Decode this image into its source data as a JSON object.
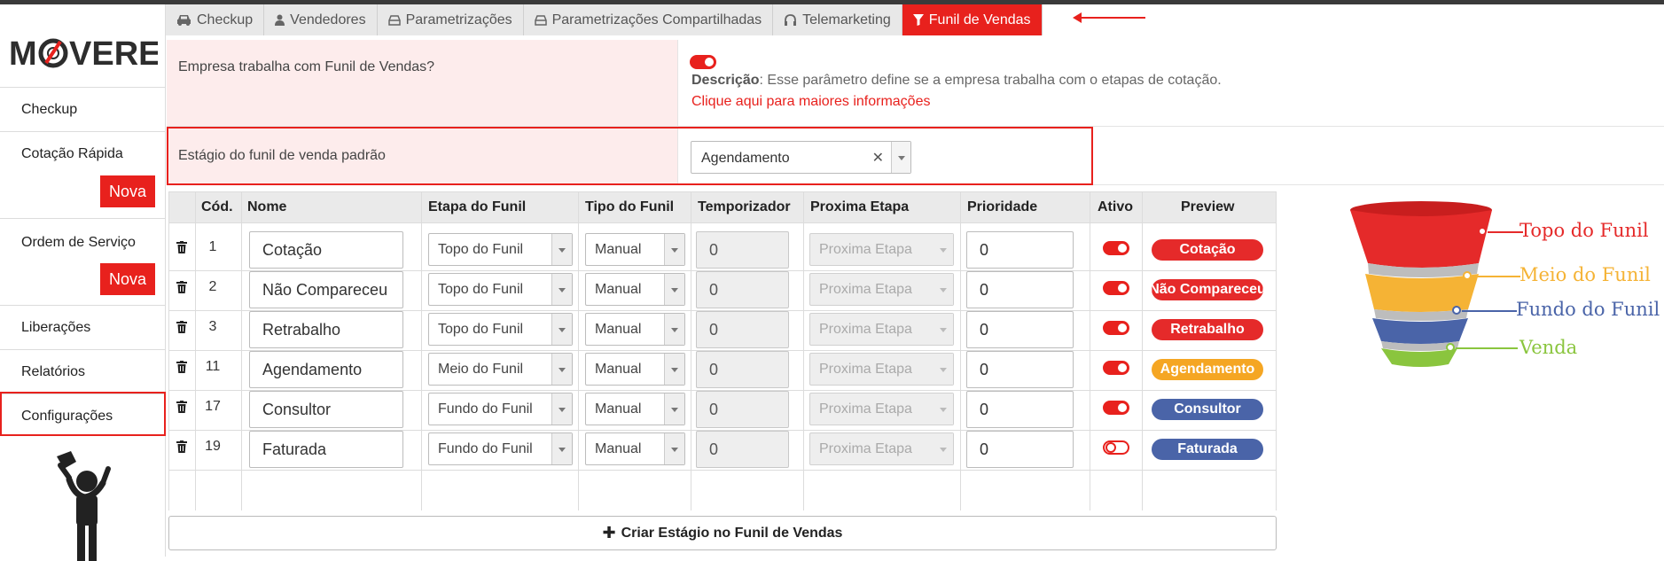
{
  "sidebar": {
    "logo_text": "MOVERE",
    "items": [
      {
        "label": "Checkup"
      },
      {
        "label": "Cotação Rápida",
        "badge": "Nova"
      },
      {
        "label": "Ordem de Serviço",
        "badge": "Nova"
      },
      {
        "label": "Liberações"
      },
      {
        "label": "Relatórios"
      },
      {
        "label": "Configurações"
      }
    ]
  },
  "tabs": [
    {
      "label": "Checkup",
      "icon": "car-icon"
    },
    {
      "label": "Vendedores",
      "icon": "user-icon"
    },
    {
      "label": "Parametrizações",
      "icon": "hdd-icon"
    },
    {
      "label": "Parametrizações Compartilhadas",
      "icon": "hdd-icon"
    },
    {
      "label": "Telemarketing",
      "icon": "headset-icon"
    },
    {
      "label": "Funil de Vendas",
      "icon": "filter-icon",
      "active": true
    }
  ],
  "params": {
    "funnel_question": "Empresa trabalha com Funil de Vendas?",
    "funnel_enabled": true,
    "desc_label": "Descrição",
    "desc_text": ": Esse parâmetro define se a empresa trabalha com o etapas de cotação.",
    "more_info": "Clique aqui para maiores informações",
    "default_stage_label": "Estágio do funil de venda padrão",
    "default_stage_value": "Agendamento"
  },
  "table": {
    "headers": {
      "code": "Cód.",
      "name": "Nome",
      "stage": "Etapa do Funil",
      "type": "Tipo do Funil",
      "timer": "Temporizador",
      "next": "Proxima Etapa",
      "priority": "Prioridade",
      "active": "Ativo",
      "preview": "Preview"
    },
    "rows": [
      {
        "code": "1",
        "name": "Cotação",
        "stage": "Topo do Funil",
        "type": "Manual",
        "timer": "0",
        "next": "Proxima Etapa",
        "priority": "0",
        "active": true,
        "preview": "Cotação",
        "color": "#e52a2a"
      },
      {
        "code": "2",
        "name": "Não Compareceu",
        "stage": "Topo do Funil",
        "type": "Manual",
        "timer": "0",
        "next": "Proxima Etapa",
        "priority": "0",
        "active": true,
        "preview": "Não Compareceu",
        "color": "#e52a2a"
      },
      {
        "code": "3",
        "name": "Retrabalho",
        "stage": "Topo do Funil",
        "type": "Manual",
        "timer": "0",
        "next": "Proxima Etapa",
        "priority": "0",
        "active": true,
        "preview": "Retrabalho",
        "color": "#e52a2a"
      },
      {
        "code": "11",
        "name": "Agendamento",
        "stage": "Meio do Funil",
        "type": "Manual",
        "timer": "0",
        "next": "Proxima Etapa",
        "priority": "0",
        "active": true,
        "preview": "Agendamento",
        "color": "#f5a623"
      },
      {
        "code": "17",
        "name": "Consultor",
        "stage": "Fundo do Funil",
        "type": "Manual",
        "timer": "0",
        "next": "Proxima Etapa",
        "priority": "0",
        "active": true,
        "preview": "Consultor",
        "color": "#4a64a8"
      },
      {
        "code": "19",
        "name": "Faturada",
        "stage": "Fundo do Funil",
        "type": "Manual",
        "timer": "0",
        "next": "Proxima Etapa",
        "priority": "0",
        "active": false,
        "preview": "Faturada",
        "color": "#4a64a8"
      }
    ],
    "add_button": "Criar Estágio no Funil de Vendas"
  },
  "funnel_legend": [
    {
      "label": "Topo do Funil",
      "color": "#e52a2a"
    },
    {
      "label": "Meio do Funil",
      "color": "#f5b335"
    },
    {
      "label": "Fundo do Funil",
      "color": "#4a64a8"
    },
    {
      "label": "Venda",
      "color": "#8ac53e"
    }
  ]
}
